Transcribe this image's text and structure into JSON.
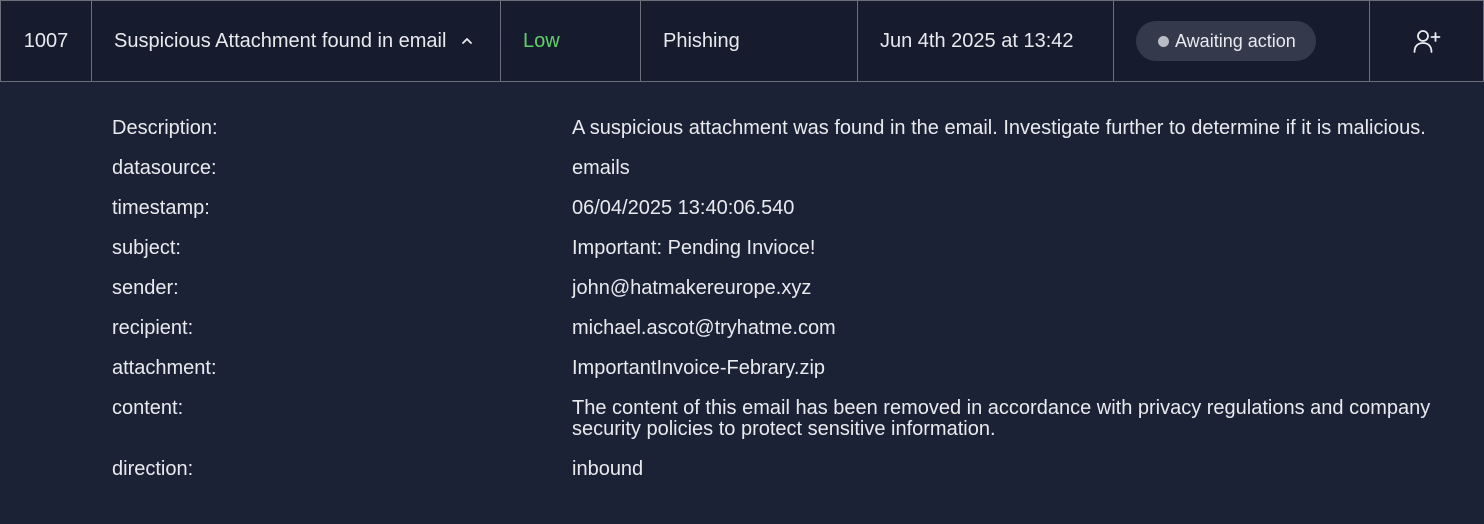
{
  "alert": {
    "id": "1007",
    "name": "Suspicious Attachment found in email",
    "severity": "Low",
    "type": "Phishing",
    "date": "Jun 4th 2025 at 13:42",
    "status": "Awaiting action",
    "severity_color": "#5fd16a",
    "icons": {
      "expand": "chevron-up-icon",
      "assign": "user-plus-icon",
      "status": "status-dot-icon"
    }
  },
  "details": [
    {
      "key": "Description:",
      "value": "A suspicious attachment was found in the email. Investigate further to determine if it is malicious."
    },
    {
      "key": "datasource:",
      "value": "emails"
    },
    {
      "key": "timestamp:",
      "value": "06/04/2025 13:40:06.540"
    },
    {
      "key": "subject:",
      "value": "Important: Pending Invioce!"
    },
    {
      "key": "sender:",
      "value": "john@hatmakereurope.xyz"
    },
    {
      "key": "recipient:",
      "value": "michael.ascot@tryhatme.com"
    },
    {
      "key": "attachment:",
      "value": "ImportantInvoice-Febrary.zip"
    },
    {
      "key": "content:",
      "value": "The content of this email has been removed in accordance with privacy regulations and company security policies to protect sensitive information."
    },
    {
      "key": "direction:",
      "value": "inbound"
    }
  ]
}
